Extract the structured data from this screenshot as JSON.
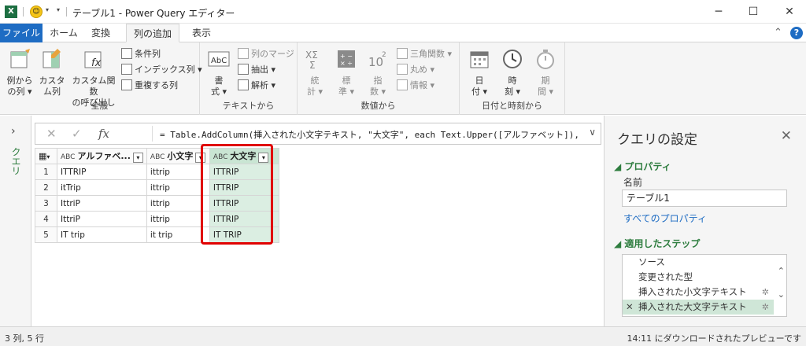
{
  "titlebar": {
    "title": "テーブル1 - Power Query エディター",
    "app_icon": "X",
    "smiley": "☺"
  },
  "tabs": [
    "ファイル",
    "ホーム",
    "変換",
    "列の追加",
    "表示"
  ],
  "ribbon": {
    "general": {
      "label": "全般",
      "example_col": [
        "例から",
        "の列 ▾"
      ],
      "custom_col": [
        "カスタ",
        "ム列"
      ],
      "custom_func": [
        "カスタム関数",
        "の呼び出し"
      ],
      "conditional": "条件列",
      "index": "インデックス列 ▾",
      "duplicate": "重複する列"
    },
    "text": {
      "label": "テキストから",
      "format": [
        "書",
        "式 ▾"
      ],
      "merge": "列のマージ",
      "extract": "抽出 ▾",
      "parse": "解析 ▾"
    },
    "number": {
      "label": "数値から",
      "stats": [
        "統",
        "計 ▾"
      ],
      "standard": [
        "標",
        "準 ▾"
      ],
      "sci": [
        "指",
        "数 ▾"
      ],
      "trig": "三角関数 ▾",
      "round": "丸め ▾",
      "info": "情報 ▾"
    },
    "datetime": {
      "label": "日付と時刻から",
      "date": [
        "日",
        "付 ▾"
      ],
      "time": [
        "時",
        "刻 ▾"
      ],
      "duration": [
        "期",
        "間 ▾"
      ]
    }
  },
  "queries_pane": {
    "label": "クエリ"
  },
  "formula": "= Table.AddColumn(挿入された小文字テキスト, \"大文字\", each Text.Upper([アルファベット]), type",
  "table": {
    "headers": [
      "アルファベ...",
      "小文字",
      "大文字"
    ],
    "rows": [
      [
        "1",
        "ITTRIP",
        "ittrip",
        "ITTRIP"
      ],
      [
        "2",
        "itTrip",
        "ittrip",
        "ITTRIP"
      ],
      [
        "3",
        "IttriP",
        "ittrip",
        "ITTRIP"
      ],
      [
        "4",
        "IttriP",
        "ittrip",
        "ITTRIP"
      ],
      [
        "5",
        "IT trip",
        "it trip",
        "IT TRIP"
      ]
    ]
  },
  "settings": {
    "title": "クエリの設定",
    "properties": "◢ プロパティ",
    "name_label": "名前",
    "name_value": "テーブル1",
    "all_props": "すべてのプロパティ",
    "applied_steps": "◢ 適用したステップ",
    "steps": [
      "ソース",
      "変更された型",
      "挿入された小文字テキスト",
      "挿入された大文字テキスト"
    ]
  },
  "status": {
    "left": "3 列, 5 行",
    "right": "14:11 にダウンロードされたプレビューです"
  }
}
